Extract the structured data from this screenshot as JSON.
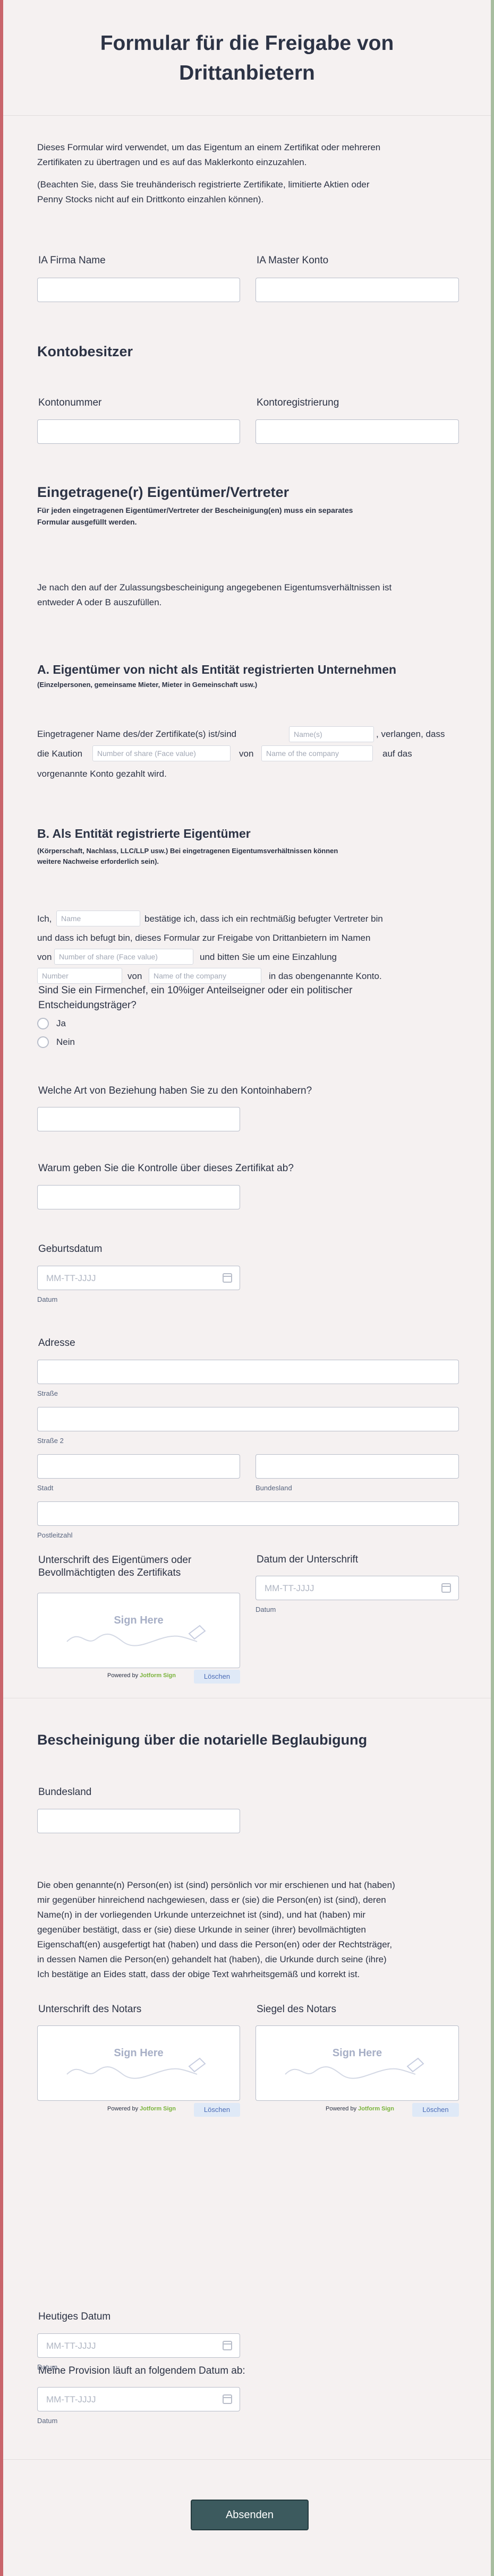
{
  "form": {
    "title_line1": "Formular für die Freigabe von",
    "title_line2": "Drittanbietern",
    "intro1_line1": "Dieses Formular wird verwendet, um das Eigentum an einem Zertifikat oder mehreren",
    "intro1_line2": "Zertifikaten zu übertragen und es auf das Maklerkonto einzuzahlen.",
    "intro2_line1": "(Beachten Sie, dass Sie treuhänderisch registrierte Zertifikate, limitierte Aktien oder",
    "intro2_line2": "Penny Stocks nicht auf ein Drittkonto einzahlen können)."
  },
  "fields": {
    "ia_firm_label": "IA Firma Name",
    "ia_master_label": "IA Master Konto",
    "account_owner_heading": "Kontobesitzer",
    "account_number_label": "Kontonummer",
    "account_registration_label": "Kontoregistrierung"
  },
  "owners": {
    "heading": "Eingetragene(r) Eigentümer/Vertreter",
    "note_line1": "Für jeden eingetragenen Eigentümer/Vertreter der Bescheinigung(en) muss ein separates",
    "note_line2": "Formular ausgefüllt werden.",
    "choose_line1": "Je nach den auf der Zulassungsbescheinigung angegebenen Eigentumsverhältnissen ist",
    "choose_line2": "entweder A oder B auszufüllen."
  },
  "section_a": {
    "heading": "A. Eigentümer von nicht als Entität registrierten Unternehmen",
    "note": "(Einzelpersonen, gemeinsame Mieter, Mieter in Gemeinschaft usw.)",
    "line1_a": "Eingetragener Name des/der Zertifikate(s) ist/sind",
    "name_ph": "Name(s)",
    "line1_b": ", verlangen, dass",
    "line2_a": "die Kaution",
    "share_ph": "Number of share (Face value)",
    "von": "von",
    "company_ph": "Name of the company",
    "line2_b": "auf das",
    "line3": "vorgenannte Konto gezahlt wird."
  },
  "section_b": {
    "heading": "B. Als Entität registrierte Eigentümer",
    "note_line1": "(Körperschaft, Nachlass, LLC/LLP usw.) Bei eingetragenen Eigentumsverhältnissen können",
    "note_line2": "weitere Nachweise erforderlich sein).",
    "ich": "Ich,",
    "name_ph": "Name",
    "line1_b": "bestätige ich, dass ich ein rechtmäßig befugter Vertreter bin",
    "line2": "und dass ich befugt bin, dieses Formular zur Freigabe von Drittanbietern im Namen",
    "von": "von",
    "share_ph": "Number of share (Face value)",
    "line3_b": "und bitten Sie um eine Einzahlung",
    "number_ph": "Number",
    "company_ph": "Name of the company",
    "line4_b": "in das obengenannte Konto."
  },
  "questions": {
    "insider_line1": "Sind Sie ein Firmenchef, ein 10%iger Anteilseigner oder ein politischer",
    "insider_line2": "Entscheidungsträger?",
    "yes": "Ja",
    "no": "Nein",
    "relationship": "Welche Art von Beziehung haben Sie zu den Kontoinhabern?",
    "why_control": "Warum geben Sie die Kontrolle über dieses Zertifikat ab?",
    "birthdate": "Geburtsdatum",
    "date_ph": "MM-TT-JJJJ",
    "date_caption": "Datum",
    "address": "Adresse",
    "street": "Straße",
    "street2": "Straße 2",
    "city": "Stadt",
    "state": "Bundesland",
    "zip": "Postleitzahl",
    "owner_sig_line1": "Unterschrift des Eigentümers oder",
    "owner_sig_line2": "Bevollmächtigten des Zertifikats",
    "sig_date": "Datum der Unterschrift"
  },
  "signature": {
    "sign_here": "Sign Here",
    "powered_by": "Powered by",
    "brand": "Jotform Sign",
    "clear": "Löschen"
  },
  "notary": {
    "heading": "Bescheinigung über die notarielle Beglaubigung",
    "state_label": "Bundesland",
    "text_l1": "Die oben genannte(n) Person(en) ist (sind) persönlich vor mir erschienen und hat (haben)",
    "text_l2": "mir gegenüber hinreichend nachgewiesen, dass er (sie) die Person(en) ist (sind), deren",
    "text_l3": "Name(n) in der vorliegenden Urkunde unterzeichnet ist (sind), und hat (haben) mir",
    "text_l4": "gegenüber bestätigt, dass er (sie) diese Urkunde in seiner (ihrer) bevollmächtigten",
    "text_l5": "Eigenschaft(en) ausgefertigt hat (haben) und dass die Person(en) oder der Rechtsträger,",
    "text_l6": "in dessen Namen die Person(en) gehandelt hat (haben), die Urkunde durch seine (ihre)",
    "text_l7": "Ich bestätige an Eides statt, dass der obige Text wahrheitsgemäß und korrekt ist.",
    "notary_sig": "Unterschrift des Notars",
    "notary_seal": "Siegel des Notars",
    "today": "Heutiges Datum",
    "commission": "Meine Provision läuft an folgendem Datum ab:"
  },
  "submit_label": "Absenden"
}
